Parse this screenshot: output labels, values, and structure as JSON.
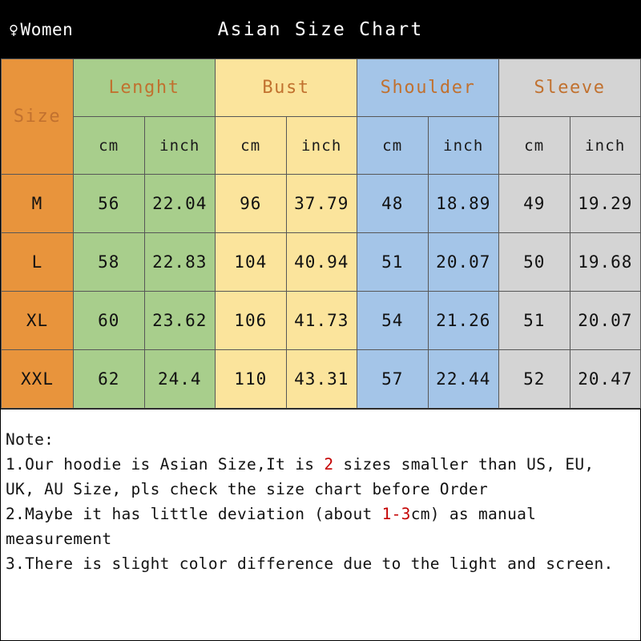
{
  "header": {
    "gender_icon": "venus-icon",
    "gender_symbol": "♀",
    "gender_label": "Women",
    "title": "Asian Size Chart"
  },
  "table": {
    "size_header": "Size",
    "groups": [
      "Lenght",
      "Bust",
      "Shoulder",
      "Sleeve"
    ],
    "units": [
      "cm",
      "inch",
      "cm",
      "inch",
      "cm",
      "inch",
      "cm",
      "inch"
    ],
    "group_colors": [
      "#a8ce8c",
      "#fbe49c",
      "#a4c5e8",
      "#d4d4d4"
    ],
    "size_color": "#e8943c",
    "label_color": "#c1712f",
    "rows": [
      {
        "size": "M",
        "values": [
          "56",
          "22.04",
          "96",
          "37.79",
          "48",
          "18.89",
          "49",
          "19.29"
        ]
      },
      {
        "size": "L",
        "values": [
          "58",
          "22.83",
          "104",
          "40.94",
          "51",
          "20.07",
          "50",
          "19.68"
        ]
      },
      {
        "size": "XL",
        "values": [
          "60",
          "23.62",
          "106",
          "41.73",
          "54",
          "21.26",
          "51",
          "20.07"
        ]
      },
      {
        "size": "XXL",
        "values": [
          "62",
          "24.4",
          "110",
          "43.31",
          "57",
          "22.44",
          "52",
          "20.47"
        ]
      }
    ]
  },
  "note": {
    "heading": "Note:",
    "item1_a": "1.Our hoodie is Asian Size,It is ",
    "item1_hl": "2",
    "item1_b": " sizes smaller than US, EU,",
    "item1_cont": "UK, AU Size, pls check the size chart before Order",
    "item2_a": "2.Maybe it has little deviation (about ",
    "item2_hl": "1-3",
    "item2_b": "cm) as manual",
    "item2_cont": "measurement",
    "item3": "3.There is slight color difference due to the light and screen.",
    "highlight_color": "#c40000"
  }
}
